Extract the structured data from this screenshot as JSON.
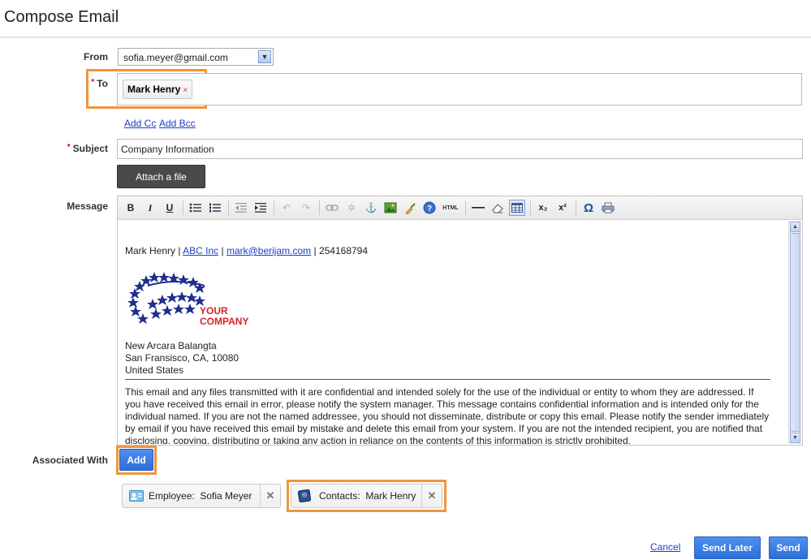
{
  "header": {
    "title": "Compose Email"
  },
  "form": {
    "from": {
      "label": "From",
      "value": "sofia.meyer@gmail.com"
    },
    "to": {
      "label": "To",
      "required_mark": "*",
      "recipients": [
        {
          "name": "Mark Henry",
          "remove": "×"
        }
      ]
    },
    "add_cc": "Add Cc",
    "add_bcc": "Add Bcc",
    "subject": {
      "label": "Subject",
      "required_mark": "*",
      "value": "Company Information"
    },
    "attach_label": "Attach a file",
    "message_label": "Message"
  },
  "editor": {
    "toolbar": [
      "bold-icon",
      "italic-icon",
      "underline-icon",
      "unordered-list-icon",
      "ordered-list-icon",
      "outdent-icon",
      "indent-icon",
      "undo-icon",
      "redo-icon",
      "link-icon",
      "unlink-icon",
      "anchor-icon",
      "image-icon",
      "cleanup-icon",
      "help-icon",
      "html-icon",
      "horizontal-rule-icon",
      "eraser-icon",
      "table-icon",
      "subscript-icon",
      "superscript-icon",
      "special-char-icon",
      "print-icon"
    ],
    "toolbar_glyphs": {
      "bold": "B",
      "italic": "I",
      "underline": "U",
      "html": "HTML",
      "subscript": "x₂",
      "superscript": "x²",
      "omega": "Ω"
    },
    "signature": {
      "name": "Mark Henry",
      "sep1": " | ",
      "company": "ABC Inc",
      "sep2": " | ",
      "email": "mark@berijam.com",
      "sep3": " | ",
      "phone": "254168794",
      "logo_text_1": "YOUR",
      "logo_text_2": "COMPANY",
      "address_1": "New Arcara Balangta",
      "address_2": "San Fransisco, CA, 10080",
      "address_3": "United States",
      "disclaimer": "This email and any files transmitted with it are confidential and intended solely for the use of the individual or entity to whom they are addressed. If you have received this email in error, please notify the system manager. This message contains confidential information and is intended only for the individual named. If you are not the named addressee, you should not disseminate, distribute or copy this email. Please notify the sender immediately by email if you have received this email by mistake and delete this email from your system. If you are not the intended recipient, you are notified that disclosing, copying, distributing or taking any action in reliance on the contents of this information is strictly prohibited."
    }
  },
  "associated": {
    "label": "Associated With",
    "add_button": "Add",
    "items": [
      {
        "type": "Employee:",
        "name": "Sofia Meyer",
        "icon": "employee-card-icon",
        "close": "✕"
      },
      {
        "type": "Contacts:",
        "name": "Mark Henry",
        "icon": "contact-card-icon",
        "close": "✕"
      }
    ]
  },
  "footer": {
    "cancel": "Cancel",
    "send_later": "Send Later",
    "send": "Send"
  },
  "colors": {
    "highlight": "#f0963c",
    "primary": "#2d6fd8",
    "link": "#1a3ec8",
    "logo_blue": "#1f2f8c",
    "logo_red": "#d8232a"
  }
}
